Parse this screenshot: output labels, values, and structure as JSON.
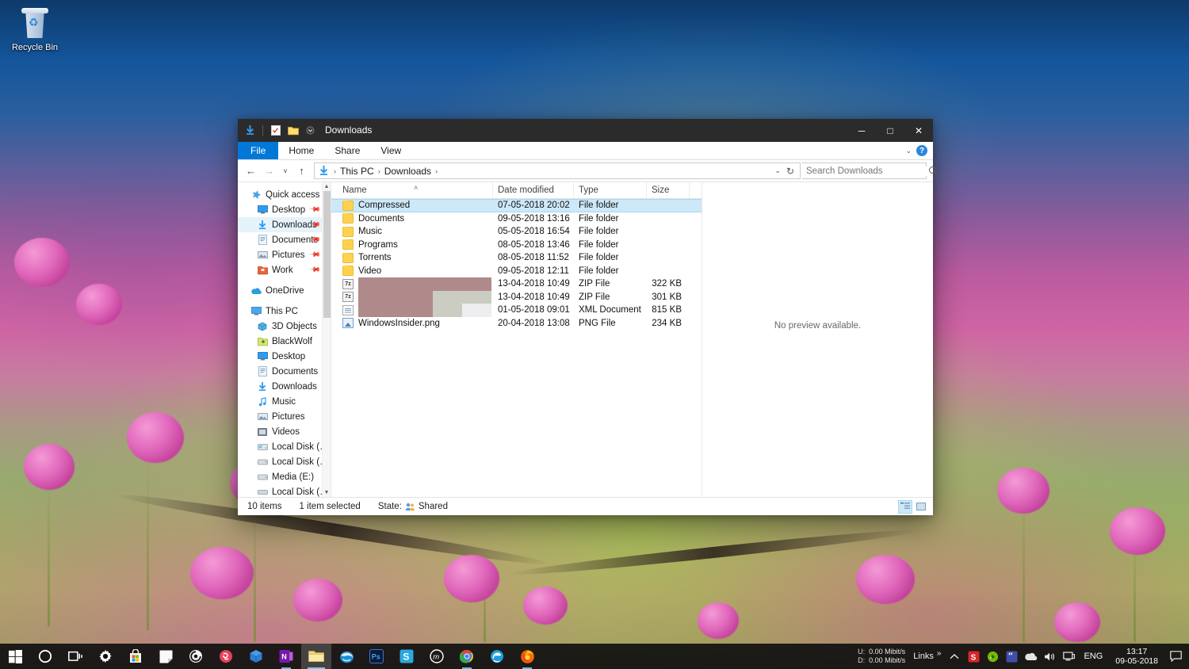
{
  "desktop": {
    "icons": [
      {
        "name": "recycle-bin",
        "label": "Recycle Bin",
        "icon": "recycle-bin-icon"
      }
    ]
  },
  "explorer": {
    "title": "Downloads",
    "quick_access_toolbar": [
      {
        "name": "downloads-icon",
        "icon": "download-arrow-icon"
      },
      {
        "name": "properties-icon",
        "icon": "checklist-icon"
      },
      {
        "name": "new-folder-icon",
        "icon": "folder-icon"
      },
      {
        "name": "customize-qat-icon",
        "icon": "chevron-down-icon"
      }
    ],
    "window_controls": {
      "minimize": "─",
      "maximize": "□",
      "close": "✕"
    },
    "ribbon": {
      "tabs": [
        {
          "label": "File",
          "active": true
        },
        {
          "label": "Home",
          "active": false
        },
        {
          "label": "Share",
          "active": false
        },
        {
          "label": "View",
          "active": false
        }
      ],
      "expand_icon": "chevron-down-icon",
      "help_icon": "help-icon",
      "help_glyph": "?"
    },
    "address_bar": {
      "back": "←",
      "forward": "→",
      "recent": "˅",
      "up": "↑",
      "path_icon": "download-arrow-icon",
      "crumbs": [
        "This PC",
        "Downloads"
      ],
      "separator": "›",
      "dropdown_icon": "chevron-down-icon",
      "refresh_icon": "refresh-icon",
      "refresh_glyph": "↻"
    },
    "search": {
      "placeholder": "Search Downloads",
      "value": "",
      "icon": "search-icon"
    },
    "nav_pane": {
      "groups": [
        {
          "header": {
            "label": "Quick access",
            "icon": "star-icon",
            "level": 0
          },
          "items": [
            {
              "label": "Desktop",
              "icon": "desktop-icon",
              "pinned": true,
              "level": 1
            },
            {
              "label": "Downloads",
              "icon": "download-arrow-icon",
              "pinned": true,
              "level": 1,
              "selected": true
            },
            {
              "label": "Documents",
              "icon": "documents-icon",
              "pinned": true,
              "level": 1
            },
            {
              "label": "Pictures",
              "icon": "pictures-icon",
              "pinned": true,
              "level": 1
            },
            {
              "label": "Work",
              "icon": "work-folder-icon",
              "pinned": true,
              "level": 1
            }
          ]
        },
        {
          "header": {
            "label": "OneDrive",
            "icon": "onedrive-icon",
            "level": 0
          },
          "items": []
        },
        {
          "header": {
            "label": "This PC",
            "icon": "this-pc-icon",
            "level": 0
          },
          "items": [
            {
              "label": "3D Objects",
              "icon": "3d-objects-icon",
              "level": 1
            },
            {
              "label": "BlackWolf",
              "icon": "user-folder-icon",
              "level": 1
            },
            {
              "label": "Desktop",
              "icon": "desktop-icon",
              "level": 1
            },
            {
              "label": "Documents",
              "icon": "documents-icon",
              "level": 1
            },
            {
              "label": "Downloads",
              "icon": "download-arrow-icon",
              "level": 1
            },
            {
              "label": "Music",
              "icon": "music-icon",
              "level": 1
            },
            {
              "label": "Pictures",
              "icon": "pictures-icon",
              "level": 1
            },
            {
              "label": "Videos",
              "icon": "videos-icon",
              "level": 1
            },
            {
              "label": "Local Disk (C:)",
              "icon": "system-drive-icon",
              "level": 1
            },
            {
              "label": "Local Disk (D:)",
              "icon": "drive-icon",
              "level": 1
            },
            {
              "label": "Media (E:)",
              "icon": "drive-icon",
              "level": 1
            },
            {
              "label": "Local Disk (F:)",
              "icon": "drive-icon",
              "level": 1
            }
          ]
        }
      ],
      "scrollbar": {
        "up_arrow": "▲",
        "down_arrow": "▼"
      }
    },
    "file_list": {
      "columns": [
        {
          "key": "name",
          "label": "Name",
          "sorted": true,
          "sort_glyph": "˄"
        },
        {
          "key": "date",
          "label": "Date modified"
        },
        {
          "key": "type",
          "label": "Type"
        },
        {
          "key": "size",
          "label": "Size"
        }
      ],
      "rows": [
        {
          "name": "Compressed",
          "date": "07-05-2018 20:02",
          "type": "File folder",
          "size": "",
          "icon": "folder-icon",
          "selected": true,
          "redacted": false
        },
        {
          "name": "Documents",
          "date": "09-05-2018 13:16",
          "type": "File folder",
          "size": "",
          "icon": "folder-icon",
          "selected": false,
          "redacted": false
        },
        {
          "name": "Music",
          "date": "05-05-2018 16:54",
          "type": "File folder",
          "size": "",
          "icon": "folder-icon",
          "selected": false,
          "redacted": false
        },
        {
          "name": "Programs",
          "date": "08-05-2018 13:46",
          "type": "File folder",
          "size": "",
          "icon": "folder-icon",
          "selected": false,
          "redacted": false
        },
        {
          "name": "Torrents",
          "date": "08-05-2018 11:52",
          "type": "File folder",
          "size": "",
          "icon": "folder-icon",
          "selected": false,
          "redacted": false
        },
        {
          "name": "Video",
          "date": "09-05-2018 12:11",
          "type": "File folder",
          "size": "",
          "icon": "folder-icon",
          "selected": false,
          "redacted": false
        },
        {
          "name": "",
          "date": "13-04-2018 10:49",
          "type": "ZIP File",
          "size": "322 KB",
          "icon": "zip-icon",
          "selected": false,
          "redacted": true
        },
        {
          "name": "",
          "date": "13-04-2018 10:49",
          "type": "ZIP File",
          "size": "301 KB",
          "icon": "zip-icon",
          "selected": false,
          "redacted": true
        },
        {
          "name": "",
          "date": "01-05-2018 09:01",
          "type": "XML Document",
          "size": "815 KB",
          "icon": "xml-icon",
          "selected": false,
          "redacted": true
        },
        {
          "name": "WindowsInsider.png",
          "date": "20-04-2018 13:08",
          "type": "PNG File",
          "size": "234 KB",
          "icon": "png-icon",
          "selected": false,
          "redacted": false
        }
      ],
      "redaction_colors": [
        "#b08a8a",
        "#cbcdc2",
        "#eeeef0"
      ]
    },
    "preview_pane": {
      "message": "No preview available."
    },
    "status_bar": {
      "item_count": "10 items",
      "selection": "1 item selected",
      "state_label": "State:",
      "state_value": "Shared",
      "state_icon": "shared-people-icon",
      "view_buttons": [
        {
          "name": "details-view-button",
          "icon": "details-view-icon",
          "active": true
        },
        {
          "name": "large-icons-view-button",
          "icon": "large-icons-view-icon",
          "active": false
        }
      ]
    }
  },
  "taskbar": {
    "left_items": [
      {
        "name": "start-button",
        "icon": "windows-logo-icon",
        "glyph": ""
      },
      {
        "name": "cortana-button",
        "icon": "cortana-circle-icon",
        "glyph": "○"
      },
      {
        "name": "task-view-button",
        "icon": "task-view-icon",
        "glyph": ""
      },
      {
        "name": "settings-button",
        "icon": "gear-icon",
        "glyph": "⚙"
      },
      {
        "name": "microsoft-store-button",
        "icon": "store-bag-icon",
        "glyph": ""
      },
      {
        "name": "sticky-notes-button",
        "icon": "sticky-note-icon",
        "glyph": ""
      },
      {
        "name": "groove-music-button",
        "icon": "groove-music-icon",
        "glyph": ""
      },
      {
        "name": "resilio-sync-button",
        "icon": "resilio-sync-icon",
        "glyph": ""
      },
      {
        "name": "3d-viewer-button",
        "icon": "3d-cube-icon",
        "glyph": ""
      },
      {
        "name": "onenote-button",
        "icon": "onenote-icon",
        "glyph": "N"
      },
      {
        "name": "file-explorer-button",
        "icon": "folder-icon",
        "glyph": "",
        "active": true
      },
      {
        "name": "thunderbird-button",
        "icon": "thunderbird-icon",
        "glyph": ""
      },
      {
        "name": "photoshop-button",
        "icon": "photoshop-icon",
        "glyph": "Ps"
      },
      {
        "name": "snagit-button",
        "icon": "snagit-icon",
        "glyph": "S"
      },
      {
        "name": "mailbird-button",
        "icon": "mailbird-icon",
        "glyph": "m"
      },
      {
        "name": "chrome-button",
        "icon": "chrome-icon",
        "glyph": ""
      },
      {
        "name": "edge-button",
        "icon": "edge-icon",
        "glyph": "e"
      },
      {
        "name": "firefox-button",
        "icon": "firefox-icon",
        "glyph": ""
      }
    ],
    "net_speed": {
      "up_label": "U:",
      "up_value": "0.00 Mibit/s",
      "down_label": "D:",
      "down_value": "0.00 Mibit/s"
    },
    "links_label": "Links",
    "links_chevron": "»",
    "tray": [
      {
        "name": "show-hidden-icons-button",
        "icon": "chevron-up-icon",
        "glyph": "˄"
      },
      {
        "name": "snagit-tray-icon",
        "icon": "snagit-icon",
        "glyph": "S"
      },
      {
        "name": "nvidia-tray-icon",
        "icon": "nvidia-icon",
        "glyph": ""
      },
      {
        "name": "bittorrent-tray-icon",
        "icon": "bittorrent-icon",
        "glyph": "″"
      },
      {
        "name": "onedrive-tray-icon",
        "icon": "onedrive-cloud-icon",
        "glyph": ""
      },
      {
        "name": "volume-tray-icon",
        "icon": "speaker-icon",
        "glyph": "🔊"
      },
      {
        "name": "network-tray-icon",
        "icon": "monitor-network-icon",
        "glyph": ""
      }
    ],
    "language": "ENG",
    "clock": {
      "time": "13:17",
      "date": "09-05-2018"
    },
    "action_center": {
      "name": "action-center-button",
      "icon": "speech-bubble-icon"
    }
  },
  "colors": {
    "accent": "#0078d7",
    "selection": "#cde8f9",
    "titlebar": "#2b2b2b",
    "taskbar": "#101010"
  }
}
